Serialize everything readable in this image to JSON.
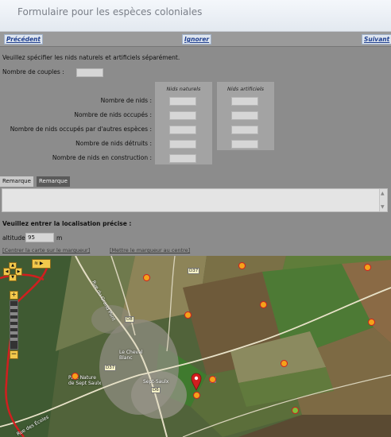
{
  "header": {
    "title": "Formulaire pour les espèces coloniales"
  },
  "nav": {
    "prev": "Précédent",
    "skip": "Ignorer",
    "next": "Suivant"
  },
  "form": {
    "instruction": "Veuillez spécifier les nids naturels et artificiels séparément.",
    "couples_label": "Nombre de couples :",
    "col_natural": "Nids naturels",
    "col_artificial": "Nids artificiels",
    "rows": [
      {
        "label": "Nombre de nids :"
      },
      {
        "label": "Nombre de nids occupés :"
      },
      {
        "label": "Nombre de nids occupés par d'autres espèces :"
      },
      {
        "label": "Nombre de nids détruits :"
      },
      {
        "label": "Nombre de nids en construction :"
      }
    ]
  },
  "tabs": {
    "remark": "Remarque",
    "protected": "Remarque protégée"
  },
  "location": {
    "heading": "Veuillez entrer la localisation précise :",
    "altitude_label": "altitude",
    "altitude_value": "95",
    "altitude_unit": "m",
    "center_link": "[Centrer la carte sur le marqueur]",
    "place_link": "[Mettre le marqueur au centre]"
  },
  "map": {
    "labels": {
      "cheval_blanc": "Le Cheval\nBlanc",
      "parc": "Parc Nature\nde Sept Saulx",
      "sept_saulx": "Sept-Saulx",
      "rue_ecoles": "Rue des Écoles",
      "route_d8": "D8",
      "route_d37a": "D37",
      "route_d37b": "D37",
      "route_d6": "D6",
      "rue_grand": "Rue du Grand Pont",
      "label_5": "5"
    },
    "accent_color": "#d11f1f",
    "marker_color": "#f4a21a"
  }
}
